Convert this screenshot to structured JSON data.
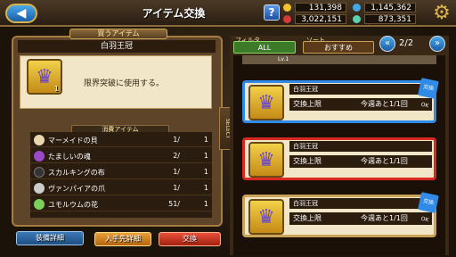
{
  "header": {
    "title": "アイテム交換",
    "help": "?",
    "currency": [
      {
        "value": "131,398",
        "color": "#f2c230"
      },
      {
        "value": "1,145,362",
        "color": "#42a8e8"
      },
      {
        "value": "3,022,151",
        "color": "#d83a3a"
      },
      {
        "value": "873,351",
        "color": "#5ad0b0"
      }
    ]
  },
  "left": {
    "tab": "買うアイテム",
    "item_name": "白羽王冠",
    "icon_count": "1",
    "description": "限界突破に使用する。",
    "materials_header": "消費アイテム",
    "materials": [
      {
        "name": "マーメイドの貝",
        "have": "1/",
        "need": "1",
        "color": "#e9d7b0"
      },
      {
        "name": "たましいの魂",
        "have": "2/",
        "need": "1",
        "color": "#9a4ac8"
      },
      {
        "name": "スカルキングの布",
        "have": "1/",
        "need": "1",
        "color": "#333"
      },
      {
        "name": "ヴァンパイアの爪",
        "have": "1/",
        "need": "1",
        "color": "#ccc"
      },
      {
        "name": "ユモルウムの花",
        "have": "51/",
        "need": "1",
        "color": "#7ad05a"
      }
    ],
    "buttons": {
      "equip": "装備詳細",
      "source": "入手先詳細",
      "exchange": "交換"
    }
  },
  "right": {
    "filter_label": "フィルタ",
    "filter_value": "ALL",
    "sort_label": "ソート",
    "sort_value": "おすすめ",
    "page": "2/2",
    "select_label": "SELECT",
    "top_strip": "Lv.1",
    "cards": [
      {
        "name": "白羽王冠",
        "limit_label": "交換上限",
        "limit_value": "今週あと1/1回",
        "badge": "交換OK",
        "border": "blue"
      },
      {
        "name": "白羽王冠",
        "limit_label": "交換上限",
        "limit_value": "今週あと1/1回",
        "badge": "",
        "border": "red"
      },
      {
        "name": "白羽王冠",
        "limit_label": "交換上限",
        "limit_value": "今週あと1/1回",
        "badge": "交換OK",
        "border": "gold"
      }
    ]
  }
}
